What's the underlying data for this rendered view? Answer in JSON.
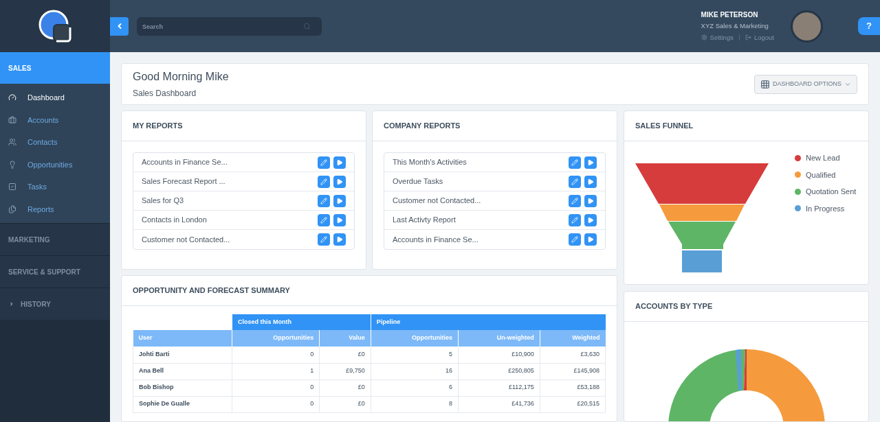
{
  "sidebar": {
    "sections": [
      {
        "label": "SALES",
        "selected": true,
        "kind": "plain",
        "items": [
          {
            "label": "Dashboard",
            "selected": true
          },
          {
            "label": "Accounts",
            "selected": false
          },
          {
            "label": "Contacts",
            "selected": false
          },
          {
            "label": "Opportunities",
            "selected": false
          },
          {
            "label": "Tasks",
            "selected": false
          },
          {
            "label": "Reports",
            "selected": false
          }
        ]
      },
      {
        "label": "MARKETING",
        "selected": false,
        "kind": "plain"
      },
      {
        "label": "SERVICE & SUPPORT",
        "selected": false,
        "kind": "plain"
      },
      {
        "label": "HISTORY",
        "selected": false,
        "kind": "toggle"
      }
    ]
  },
  "header": {
    "search": {
      "placeholder": "Search"
    },
    "user": {
      "name": "MIKE PETERSON",
      "company": "XYZ Sales & Marketing",
      "links": [
        "Settings",
        "Logout"
      ]
    },
    "help": "?"
  },
  "welcome": {
    "title": "Good Morning Mike",
    "subtitle": "Sales Dashboard",
    "options_button": "DASHBOARD OPTIONS"
  },
  "my_reports": {
    "title": "MY REPORTS",
    "items": [
      "Accounts in Finance Se...",
      "Sales Forecast Report ...",
      "Sales for Q3",
      "Contacts in London",
      "Customer not Contacted..."
    ]
  },
  "company_reports": {
    "title": "COMPANY REPORTS",
    "items": [
      "This Month's Activities",
      "Overdue Tasks",
      "Customer not Contacted...",
      "Last Activty Report",
      "Accounts in Finance Se..."
    ]
  },
  "sales_funnel": {
    "title": "SALES FUNNEL",
    "legend": [
      {
        "label": "New Lead",
        "color": "#d63c3c"
      },
      {
        "label": "Qualified",
        "color": "#f59b3d"
      },
      {
        "label": "Quotation Sent",
        "color": "#5fb566"
      },
      {
        "label": "In Progress",
        "color": "#599fd6"
      }
    ]
  },
  "summary": {
    "title": "OPPORTUNITY AND FORECAST SUMMARY",
    "first_column": "User",
    "groups": [
      {
        "label": "Closed this Month",
        "columns": [
          "Opportunities",
          "Value"
        ]
      },
      {
        "label": "Pipeline",
        "columns": [
          "Opportunities",
          "Un-weighted",
          "Weighted"
        ]
      }
    ],
    "rows": [
      {
        "user": "Johti Barti",
        "cells": [
          "0",
          "£0",
          "5",
          "£10,900",
          "£3,630"
        ]
      },
      {
        "user": "Ana Bell",
        "cells": [
          "1",
          "£9,750",
          "16",
          "£250,805",
          "£145,908"
        ]
      },
      {
        "user": "Bob Bishop",
        "cells": [
          "0",
          "£0",
          "6",
          "£112,175",
          "£53,188"
        ]
      },
      {
        "user": "Sophie De Gualle",
        "cells": [
          "0",
          "£0",
          "8",
          "£41,736",
          "£20,515"
        ]
      }
    ]
  },
  "accounts_by_type": {
    "title": "ACCOUNTS BY TYPE"
  }
}
